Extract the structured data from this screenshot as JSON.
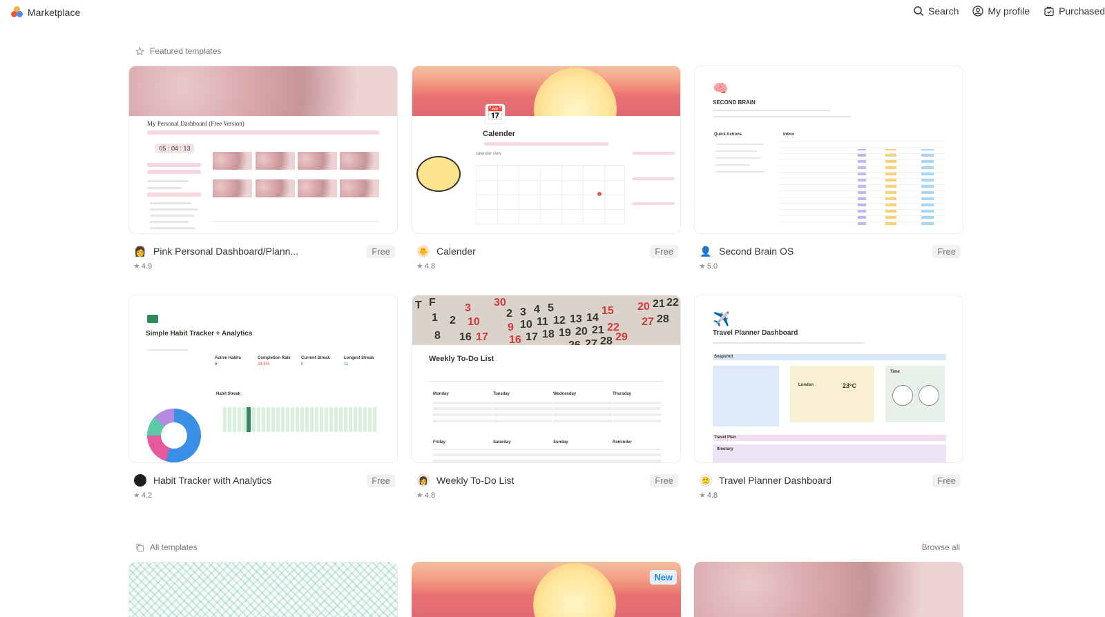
{
  "header": {
    "brand": "Marketplace",
    "nav": [
      {
        "label": "Search",
        "icon": "search-icon"
      },
      {
        "label": "My profile",
        "icon": "profile-icon"
      },
      {
        "label": "Purchased",
        "icon": "purchased-icon"
      }
    ]
  },
  "featured": {
    "title": "Featured templates",
    "cards": [
      {
        "title": "Pink Personal Dashboard/Plann...",
        "price": "Free",
        "rating": "4.9",
        "thumb_title": "My Personal Dashboard (Free Version)",
        "thumb_time": "05 : 04 : 13"
      },
      {
        "title": "Calender",
        "price": "Free",
        "rating": "4.8",
        "thumb_title": "Calender",
        "thumb_sub": "calendar view"
      },
      {
        "title": "Second Brain OS",
        "price": "Free",
        "rating": "5.0",
        "thumb_title": "SECOND BRAIN",
        "thumb_left": "Quick Actions",
        "thumb_right": "Inbox"
      },
      {
        "title": "Habit Tracker with Analytics",
        "price": "Free",
        "rating": "4.2",
        "thumb_title": "Simple Habit Tracker + Analytics",
        "thumb_stats": [
          "Active Habits",
          "Completion Rate",
          "Current Streak",
          "Longest Streak"
        ],
        "thumb_values": [
          "5",
          "24.5%",
          "0",
          "11"
        ],
        "thumb_streak": "Habit Streak"
      },
      {
        "title": "Weekly To-Do List",
        "price": "Free",
        "rating": "4.8",
        "thumb_title": "Weekly To-Do List",
        "thumb_days": [
          "Monday",
          "Tuesday",
          "Wednesday",
          "Thursday",
          "Friday",
          "Saturday",
          "Sunday",
          "Reminder"
        ]
      },
      {
        "title": "Travel Planner Dashboard",
        "price": "Free",
        "rating": "4.8",
        "thumb_title": "Travel Planner Dashboard",
        "thumb_snapshot": "Snapshot",
        "thumb_city": "London",
        "thumb_temp": "23°C",
        "thumb_time": "Time",
        "thumb_plan": "Travel Plan",
        "thumb_itinerary": "Itinerary"
      }
    ]
  },
  "all": {
    "title": "All templates",
    "browse": "Browse all",
    "new_badge": "New"
  }
}
